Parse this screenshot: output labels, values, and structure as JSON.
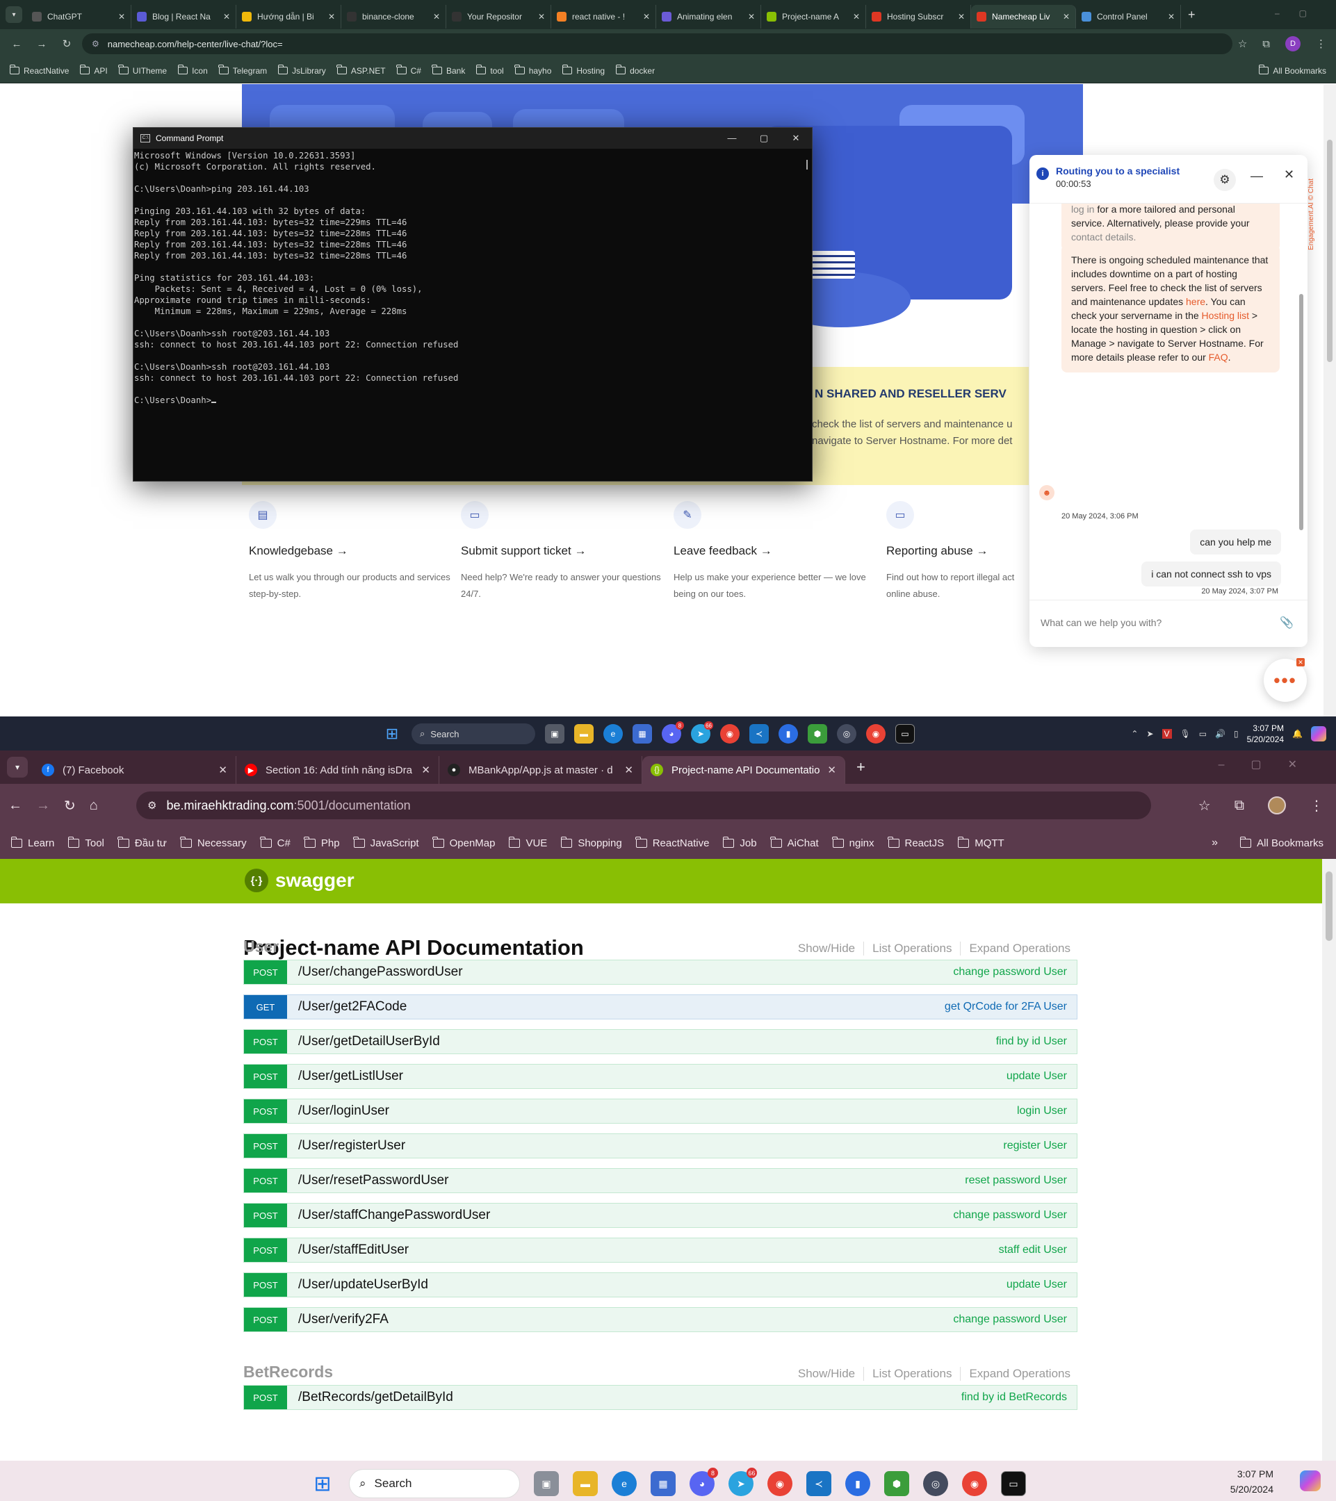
{
  "screen1": {
    "tabs": [
      {
        "label": "ChatGPT",
        "color": "#555555"
      },
      {
        "label": "Blog | React Na",
        "color": "#5b5bd6"
      },
      {
        "label": "Hướng dẫn | Bi",
        "color": "#f0b90b"
      },
      {
        "label": "binance-clone",
        "color": "#333333"
      },
      {
        "label": "Your Repositor",
        "color": "#333333"
      },
      {
        "label": "react native - !",
        "color": "#f48024"
      },
      {
        "label": "Animating elen",
        "color": "#6b5bd6"
      },
      {
        "label": "Project-name A",
        "color": "#89bf04"
      },
      {
        "label": "Hosting Subscr",
        "color": "#de3723"
      },
      {
        "label": "Namecheap Liv",
        "color": "#de3723"
      },
      {
        "label": "Control Panel",
        "color": "#4a90d9"
      }
    ],
    "url": "namecheap.com/help-center/live-chat/?loc=",
    "avatar_letter": "D",
    "bookmarks": [
      "ReactNative",
      "API",
      "UITheme",
      "Icon",
      "Telegram",
      "JsLibrary",
      "ASP.NET",
      "C#",
      "Bank",
      "tool",
      "hayho",
      "Hosting",
      "docker"
    ],
    "all_bookmarks": "All Bookmarks",
    "banner": {
      "title": "N SHARED AND RESELLER SERV",
      "line1": "check the list of servers and maintenance u",
      "line2": "navigate to Server Hostname. For more det"
    },
    "cards": [
      {
        "icon": "book-icon",
        "glyph": "▤",
        "title": "Knowledgebase →",
        "text": "Let us walk you through our products and services step-by-step."
      },
      {
        "icon": "ticket-icon",
        "glyph": "▭",
        "title": "Submit support ticket →",
        "text": "Need help? We're ready to answer your questions 24/7."
      },
      {
        "icon": "feedback-icon",
        "glyph": "✎",
        "title": "Leave feedback →",
        "text": "Help us make your experience better — we love being on our toes."
      },
      {
        "icon": "abuse-icon",
        "glyph": "▭",
        "title": "Reporting abuse →",
        "text": "Find out how to report illegal act online abuse."
      }
    ],
    "cmd": {
      "title": "Command Prompt",
      "output": "Microsoft Windows [Version 10.0.22631.3593]\n(c) Microsoft Corporation. All rights reserved.\n\nC:\\Users\\Doanh>ping 203.161.44.103\n\nPinging 203.161.44.103 with 32 bytes of data:\nReply from 203.161.44.103: bytes=32 time=229ms TTL=46\nReply from 203.161.44.103: bytes=32 time=228ms TTL=46\nReply from 203.161.44.103: bytes=32 time=228ms TTL=46\nReply from 203.161.44.103: bytes=32 time=228ms TTL=46\n\nPing statistics for 203.161.44.103:\n    Packets: Sent = 4, Received = 4, Lost = 0 (0% loss),\nApproximate round trip times in milli-seconds:\n    Minimum = 228ms, Maximum = 229ms, Average = 228ms\n\nC:\\Users\\Doanh>ssh root@203.161.44.103\nssh: connect to host 203.161.44.103 port 22: Connection refused\n\nC:\\Users\\Doanh>ssh root@203.161.44.103\nssh: connect to host 203.161.44.103 port 22: Connection refused\n\nC:\\Users\\Doanh>"
    },
    "chat": {
      "title": "Routing you to a specialist",
      "timer": "00:00:53",
      "msg1_a": "log in",
      "msg1_b": " for a more tailored and personal service. Alternatively, please provide your ",
      "msg1_c": "contact details.",
      "msg2_a": "There is ongoing scheduled maintenance that includes downtime on a part of hosting servers. Feel free to check the list of servers and maintenance updates ",
      "msg2_here": "here",
      "msg2_b": ". You can check your servername in the ",
      "msg2_hosting": "Hosting list",
      "msg2_c": " > locate the hosting in question > click on Manage > navigate to Server Hostname. For more details please refer to our ",
      "msg2_faq": "FAQ",
      "msg2_d": ".",
      "time1": "20 May 2024, 3:06 PM",
      "out1": "can you help me",
      "out2": "i can not connect ssh to vps",
      "time2": "20 May 2024, 3:07 PM",
      "placeholder": "What can we help you with?",
      "side_label": "Engagement.AI © Chat"
    },
    "taskbar": {
      "search": "Search",
      "time": "3:07 PM",
      "date": "5/20/2024"
    }
  },
  "screen2": {
    "tabs": [
      {
        "label": "(7) Facebook",
        "color": "#1877f2",
        "glyph": "f"
      },
      {
        "label": "Section 16: Add tính năng isDra",
        "color": "#ff0000",
        "glyph": "▶"
      },
      {
        "label": "MBankApp/App.js at master · d",
        "color": "#222222",
        "glyph": "●"
      },
      {
        "label": "Project-name API Documentatio",
        "color": "#89bf04",
        "glyph": "{}"
      }
    ],
    "url_host": "be.miraehktrading.com",
    "url_rest": ":5001/documentation",
    "bookmarks": [
      "Learn",
      "Tool",
      "Đầu tư",
      "Necessary",
      "C#",
      "Php",
      "JavaScript",
      "OpenMap",
      "VUE",
      "Shopping",
      "ReactNative",
      "Job",
      "AiChat",
      "nginx",
      "ReactJS",
      "MQTT"
    ],
    "all_bookmarks": "All Bookmarks",
    "swagger": {
      "logo": "swagger",
      "title": "Project-name API Documentation",
      "show_hide": "Show/Hide",
      "list_ops": "List Operations",
      "expand_ops": "Expand Operations",
      "sections": [
        {
          "name": "User",
          "ops": [
            {
              "method": "POST",
              "path": "/User/changePasswordUser",
              "summary": "change password User"
            },
            {
              "method": "GET",
              "path": "/User/get2FACode",
              "summary": "get QrCode for 2FA User"
            },
            {
              "method": "POST",
              "path": "/User/getDetailUserById",
              "summary": "find by id User"
            },
            {
              "method": "POST",
              "path": "/User/getListlUser",
              "summary": "update User"
            },
            {
              "method": "POST",
              "path": "/User/loginUser",
              "summary": "login User"
            },
            {
              "method": "POST",
              "path": "/User/registerUser",
              "summary": "register User"
            },
            {
              "method": "POST",
              "path": "/User/resetPasswordUser",
              "summary": "reset password User"
            },
            {
              "method": "POST",
              "path": "/User/staffChangePasswordUser",
              "summary": "change password User"
            },
            {
              "method": "POST",
              "path": "/User/staffEditUser",
              "summary": "staff edit User"
            },
            {
              "method": "POST",
              "path": "/User/updateUserById",
              "summary": "update User"
            },
            {
              "method": "POST",
              "path": "/User/verify2FA",
              "summary": "change password User"
            }
          ]
        },
        {
          "name": "BetRecords",
          "ops": [
            {
              "method": "POST",
              "path": "/BetRecords/getDetailById",
              "summary": "find by id BetRecords"
            }
          ]
        }
      ]
    },
    "taskbar": {
      "search": "Search",
      "time": "3:07 PM",
      "date": "5/20/2024"
    }
  }
}
